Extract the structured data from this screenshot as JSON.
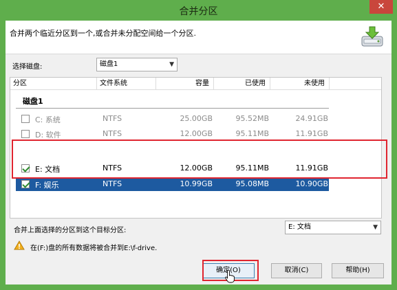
{
  "window": {
    "title": "合并分区",
    "close_label": "✕"
  },
  "header": {
    "instruction": "合并两个临近分区到一个,或合并未分配空间给一个分区."
  },
  "disk_select": {
    "label": "选择磁盘:",
    "value": "磁盘1"
  },
  "table": {
    "columns": [
      "分区",
      "文件系统",
      "容量",
      "已使用",
      "未使用"
    ],
    "group": "磁盘1",
    "rows": [
      {
        "name": "C:  系统",
        "fs": "NTFS",
        "capacity": "25.00GB",
        "used": "95.52MB",
        "free": "24.91GB",
        "checked": false,
        "enabled": false,
        "selected": false
      },
      {
        "name": "D:  软件",
        "fs": "NTFS",
        "capacity": "12.00GB",
        "used": "95.11MB",
        "free": "11.91GB",
        "checked": false,
        "enabled": false,
        "selected": false
      },
      {
        "name": "E:  文档",
        "fs": "NTFS",
        "capacity": "12.00GB",
        "used": "95.11MB",
        "free": "11.91GB",
        "checked": true,
        "enabled": true,
        "selected": false
      },
      {
        "name": "F:  娱乐",
        "fs": "NTFS",
        "capacity": "10.99GB",
        "used": "95.08MB",
        "free": "10.90GB",
        "checked": true,
        "enabled": true,
        "selected": true
      }
    ]
  },
  "target": {
    "label": "合并上面选择的分区到这个目标分区:",
    "value": "E:  文档"
  },
  "warning": {
    "text": "在(F:)盘的所有数据将被合并到E:\\f-drive."
  },
  "buttons": {
    "ok": "确定(O)",
    "cancel": "取消(C)",
    "help": "帮助(H)"
  },
  "colors": {
    "titlebar": "#5fae4c",
    "selection": "#1d5aa0",
    "highlight_border": "#e0242f"
  }
}
